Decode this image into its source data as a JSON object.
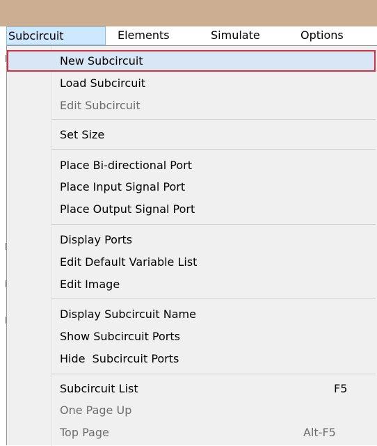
{
  "menubar": {
    "items": [
      "Subcircuit",
      "Elements",
      "Simulate",
      "Options"
    ]
  },
  "dropdown": {
    "items": [
      {
        "label": "New Subcircuit",
        "shortcut": "",
        "disabled": false
      },
      {
        "label": "Load Subcircuit",
        "shortcut": "",
        "disabled": false
      },
      {
        "label": "Edit Subcircuit",
        "shortcut": "",
        "disabled": true
      },
      {
        "label": "Set Size",
        "shortcut": "",
        "disabled": false
      },
      {
        "label": "Place Bi-directional Port",
        "shortcut": "",
        "disabled": false
      },
      {
        "label": "Place Input Signal Port",
        "shortcut": "",
        "disabled": false
      },
      {
        "label": "Place Output Signal Port",
        "shortcut": "",
        "disabled": false
      },
      {
        "label": "Display Ports",
        "shortcut": "",
        "disabled": false
      },
      {
        "label": "Edit Default Variable List",
        "shortcut": "",
        "disabled": false
      },
      {
        "label": "Edit Image",
        "shortcut": "",
        "disabled": false
      },
      {
        "label": "Display Subcircuit Name",
        "shortcut": "",
        "disabled": false
      },
      {
        "label": "Show Subcircuit Ports",
        "shortcut": "",
        "disabled": false
      },
      {
        "label": "Hide  Subcircuit Ports",
        "shortcut": "",
        "disabled": false
      },
      {
        "label": "Subcircuit List",
        "shortcut": "F5",
        "disabled": false
      },
      {
        "label": "One Page Up",
        "shortcut": "",
        "disabled": true
      },
      {
        "label": "Top Page",
        "shortcut": "Alt-F5",
        "disabled": true
      }
    ]
  },
  "colors": {
    "titlebar": "#ccae93",
    "active_menu_bg": "#cde8ff",
    "highlight_border": "#d4303f",
    "disabled_text": "#6d6d6d"
  }
}
